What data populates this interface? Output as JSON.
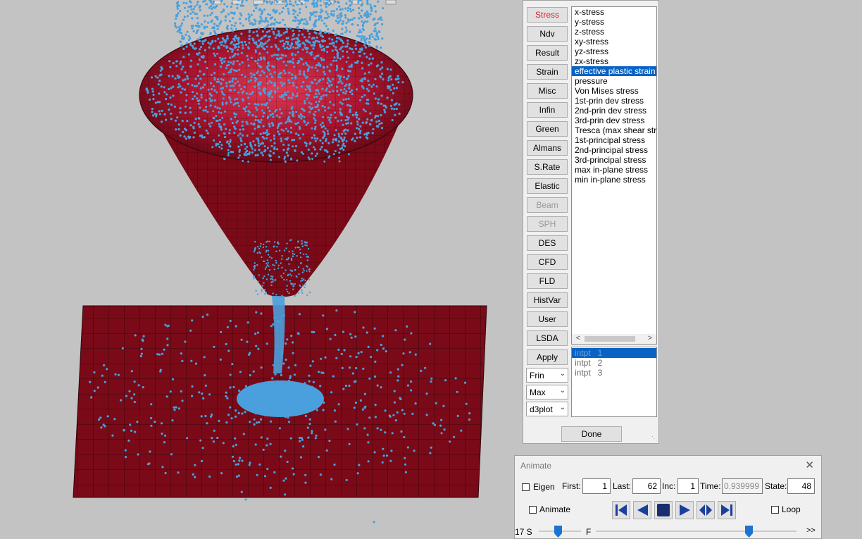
{
  "fringe_panel": {
    "categories": [
      {
        "label": "Stress",
        "state": "active"
      },
      {
        "label": "Ndv",
        "state": "normal"
      },
      {
        "label": "Result",
        "state": "normal"
      },
      {
        "label": "Strain",
        "state": "normal"
      },
      {
        "label": "Misc",
        "state": "normal"
      },
      {
        "label": "Infin",
        "state": "normal"
      },
      {
        "label": "Green",
        "state": "normal"
      },
      {
        "label": "Almans",
        "state": "normal"
      },
      {
        "label": "S.Rate",
        "state": "normal"
      },
      {
        "label": "Elastic",
        "state": "normal"
      },
      {
        "label": "Beam",
        "state": "disabled"
      },
      {
        "label": "SPH",
        "state": "disabled"
      },
      {
        "label": "DES",
        "state": "normal"
      },
      {
        "label": "CFD",
        "state": "normal"
      },
      {
        "label": "FLD",
        "state": "normal"
      },
      {
        "label": "HistVar",
        "state": "normal"
      },
      {
        "label": "User",
        "state": "normal"
      },
      {
        "label": "LSDA",
        "state": "normal"
      },
      {
        "label": "Apply",
        "state": "normal"
      }
    ],
    "dropdowns": [
      "Frin",
      "Max",
      "d3plot"
    ],
    "components": [
      "x-stress",
      "y-stress",
      "z-stress",
      "xy-stress",
      "yz-stress",
      "zx-stress",
      "effective plastic strain",
      "pressure",
      "Von Mises stress",
      "1st-prin dev stress",
      "2nd-prin dev stress",
      "3rd-prin dev stress",
      "Tresca (max shear stress)",
      "1st-principal stress",
      "2nd-principal stress",
      "3rd-principal stress",
      "max in-plane stress",
      "min in-plane stress"
    ],
    "selected_component": "effective plastic strain",
    "integration_points": [
      "intpt   1",
      "intpt   2",
      "intpt   3"
    ],
    "selected_intpt": 0,
    "done_label": "Done"
  },
  "animate_panel": {
    "title": "Animate",
    "eigen_label": "Eigen",
    "first_label": "First:",
    "first_value": "1",
    "last_label": "Last:",
    "last_value": "62",
    "inc_label": "Inc:",
    "inc_value": "1",
    "time_label": "Time:",
    "time_value": "0.939999",
    "state_label": "State:",
    "state_value": "48",
    "animate_label": "Animate",
    "loop_label": "Loop",
    "speed_label": "17 S",
    "frame_label": "F",
    "more_label": ">>",
    "speed_fraction": 0.45,
    "frame_fraction": 0.76
  },
  "colors": {
    "mesh_red": "#7a0a18",
    "mesh_line": "#2a0508",
    "particle_blue": "#4aa0dc",
    "selection_blue": "#0a63c4",
    "active_tab_red": "#e0202a"
  }
}
